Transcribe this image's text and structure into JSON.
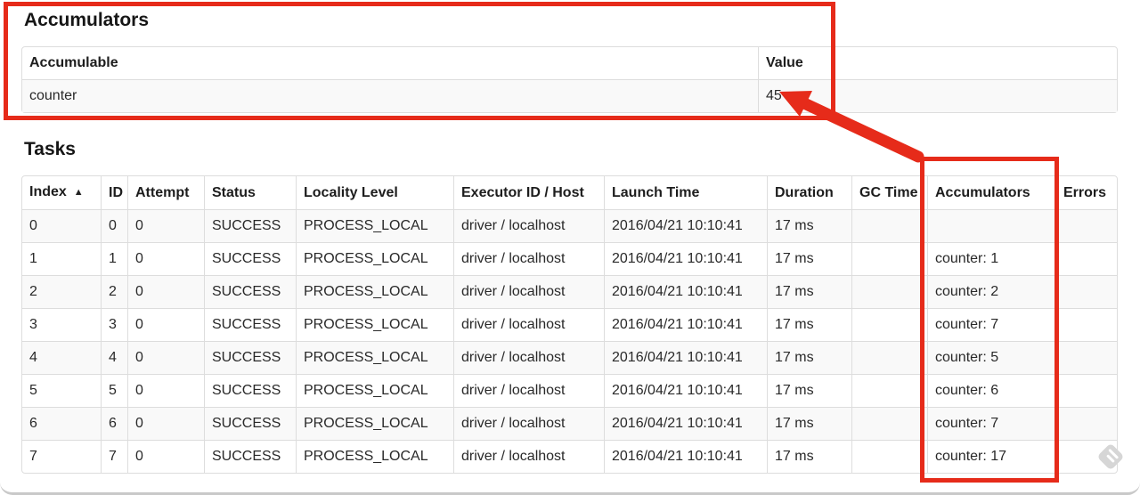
{
  "annotation_color": "#e62b1a",
  "accumulators_section": {
    "title": "Accumulators",
    "table": {
      "headers": [
        "Accumulable",
        "Value"
      ],
      "rows": [
        [
          "counter",
          "45"
        ]
      ]
    }
  },
  "tasks_section": {
    "title": "Tasks",
    "table": {
      "headers": [
        "Index",
        "ID",
        "Attempt",
        "Status",
        "Locality Level",
        "Executor ID / Host",
        "Launch Time",
        "Duration",
        "GC Time",
        "Accumulators",
        "Errors"
      ],
      "sorted_header": "Index",
      "sort_glyph": "▲",
      "rows": [
        [
          "0",
          "0",
          "0",
          "SUCCESS",
          "PROCESS_LOCAL",
          "driver / localhost",
          "2016/04/21 10:10:41",
          "17 ms",
          "",
          "",
          ""
        ],
        [
          "1",
          "1",
          "0",
          "SUCCESS",
          "PROCESS_LOCAL",
          "driver / localhost",
          "2016/04/21 10:10:41",
          "17 ms",
          "",
          "counter: 1",
          ""
        ],
        [
          "2",
          "2",
          "0",
          "SUCCESS",
          "PROCESS_LOCAL",
          "driver / localhost",
          "2016/04/21 10:10:41",
          "17 ms",
          "",
          "counter: 2",
          ""
        ],
        [
          "3",
          "3",
          "0",
          "SUCCESS",
          "PROCESS_LOCAL",
          "driver / localhost",
          "2016/04/21 10:10:41",
          "17 ms",
          "",
          "counter: 7",
          ""
        ],
        [
          "4",
          "4",
          "0",
          "SUCCESS",
          "PROCESS_LOCAL",
          "driver / localhost",
          "2016/04/21 10:10:41",
          "17 ms",
          "",
          "counter: 5",
          ""
        ],
        [
          "5",
          "5",
          "0",
          "SUCCESS",
          "PROCESS_LOCAL",
          "driver / localhost",
          "2016/04/21 10:10:41",
          "17 ms",
          "",
          "counter: 6",
          ""
        ],
        [
          "6",
          "6",
          "0",
          "SUCCESS",
          "PROCESS_LOCAL",
          "driver / localhost",
          "2016/04/21 10:10:41",
          "17 ms",
          "",
          "counter: 7",
          ""
        ],
        [
          "7",
          "7",
          "0",
          "SUCCESS",
          "PROCESS_LOCAL",
          "driver / localhost",
          "2016/04/21 10:10:41",
          "17 ms",
          "",
          "counter: 17",
          ""
        ]
      ]
    }
  },
  "watermark": {
    "icon": "striped-diamond-watermark-icon"
  }
}
